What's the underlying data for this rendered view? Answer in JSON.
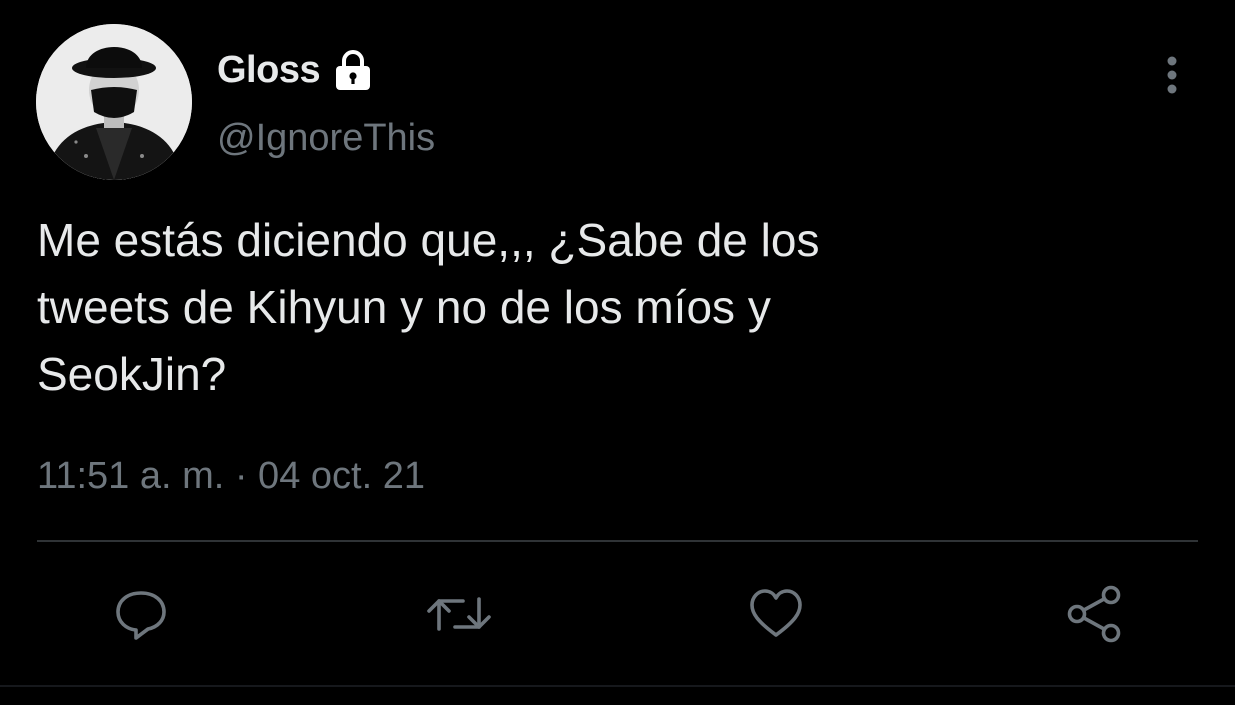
{
  "tweet": {
    "author": {
      "display_name": "Gloss",
      "handle": "@IgnoreThis",
      "avatar_icon": "avatar-photo",
      "protected_icon": "lock-icon"
    },
    "text": "Me estás diciendo que,,, ¿Sabe de los\ntweets de Kihyun y no de los míos y\nSeokJin?",
    "timestamp": "11:51 a. m. · 04 oct. 21",
    "more_icon": "more-vertical-icon"
  },
  "actions": {
    "reply_icon": "reply-icon",
    "retweet_icon": "retweet-icon",
    "like_icon": "like-heart-icon",
    "share_icon": "share-icon"
  },
  "colors": {
    "background": "#000000",
    "primary_text": "#e7e9ea",
    "secondary_text": "#6e767d",
    "divider": "#2f3336"
  }
}
